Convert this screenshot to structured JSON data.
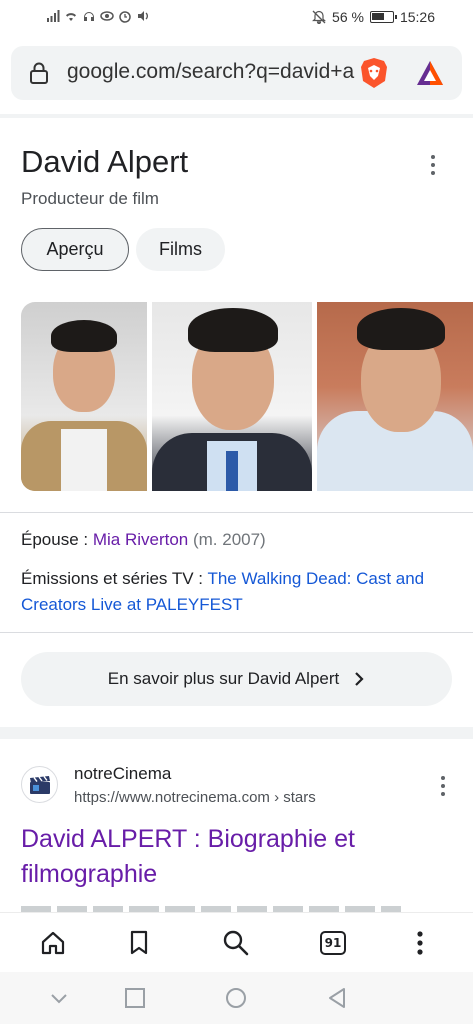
{
  "status_bar": {
    "battery_text": "56 %",
    "time": "15:26"
  },
  "address_bar": {
    "url": "google.com/search?q=david+a"
  },
  "knowledge_panel": {
    "title": "David Alpert",
    "subtitle": "Producteur de film",
    "chips": [
      "Aperçu",
      "Films"
    ],
    "facts": {
      "spouse_label": "Épouse : ",
      "spouse_name": "Mia Riverton",
      "spouse_detail": " (m. 2007)",
      "tv_label": "Émissions et séries TV : ",
      "tv_value": "The Walking Dead: Cast and Creators Live at PALEYFEST"
    },
    "more_button": "En savoir plus sur David Alpert"
  },
  "result": {
    "site_name": "notreCinema",
    "url_base": "https://www.notrecinema.com",
    "url_path": " › stars",
    "title": "David ALPERT : Biographie et filmographie"
  },
  "toolbar": {
    "tab_count": "91"
  }
}
